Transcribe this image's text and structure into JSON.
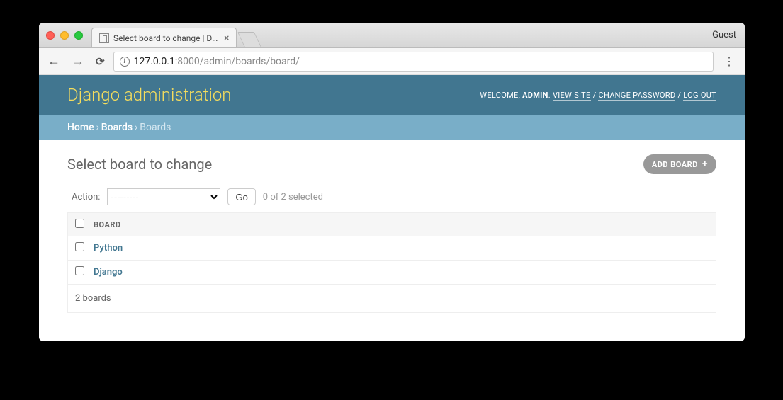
{
  "browser": {
    "tab_title": "Select board to change | Djang",
    "guest_label": "Guest",
    "url_host": "127.0.0.1",
    "url_port_path": ":8000/admin/boards/board/"
  },
  "header": {
    "site_title": "Django administration",
    "welcome": "WELCOME, ",
    "username": "ADMIN",
    "view_site": "VIEW SITE",
    "change_password": "CHANGE PASSWORD",
    "log_out": "LOG OUT"
  },
  "breadcrumbs": {
    "home": "Home",
    "app": "Boards",
    "model": "Boards"
  },
  "page": {
    "heading": "Select board to change",
    "add_button": "ADD BOARD",
    "action_label": "Action:",
    "action_default_option": "---------",
    "go_button": "Go",
    "selection_counter": "0 of 2 selected",
    "column_header": "BOARD",
    "rows": [
      {
        "name": "Python"
      },
      {
        "name": "Django"
      }
    ],
    "summary": "2 boards"
  }
}
